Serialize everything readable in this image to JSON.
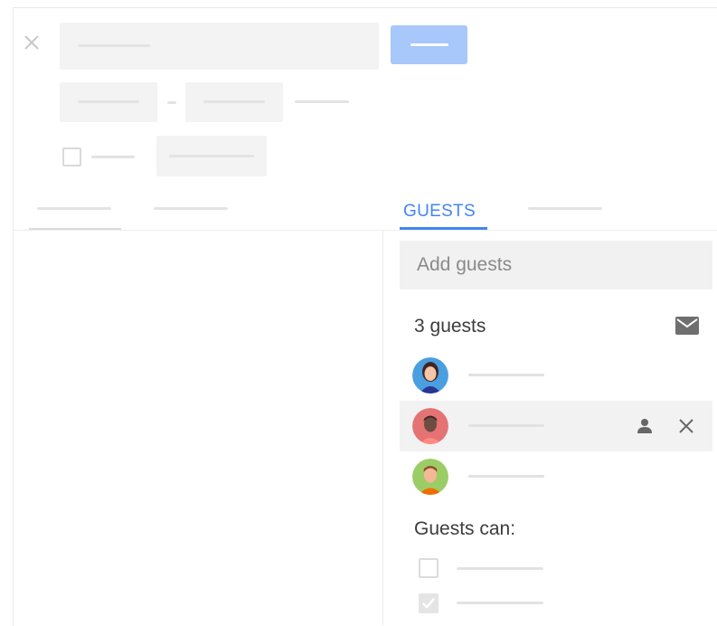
{
  "dialog": {
    "close_icon": "close-icon",
    "save_button_color": "#a8c7fa"
  },
  "tabs": {
    "guests_label": "GUESTS",
    "accent_color": "#4285f4"
  },
  "guests_panel": {
    "add_placeholder": "Add guests",
    "count_label": "3 guests",
    "email_icon": "mail-icon",
    "guests": [
      {
        "avatar": "woman-avatar",
        "avatar_color": "#4a9fe0"
      },
      {
        "avatar": "man-avatar-red",
        "avatar_color": "#e57373",
        "actions": [
          "person-icon",
          "close-icon"
        ]
      },
      {
        "avatar": "man-avatar-green",
        "avatar_color": "#9ccc65"
      }
    ],
    "permissions_title": "Guests can:",
    "permissions": [
      {
        "checked": false
      },
      {
        "checked": true
      }
    ]
  }
}
